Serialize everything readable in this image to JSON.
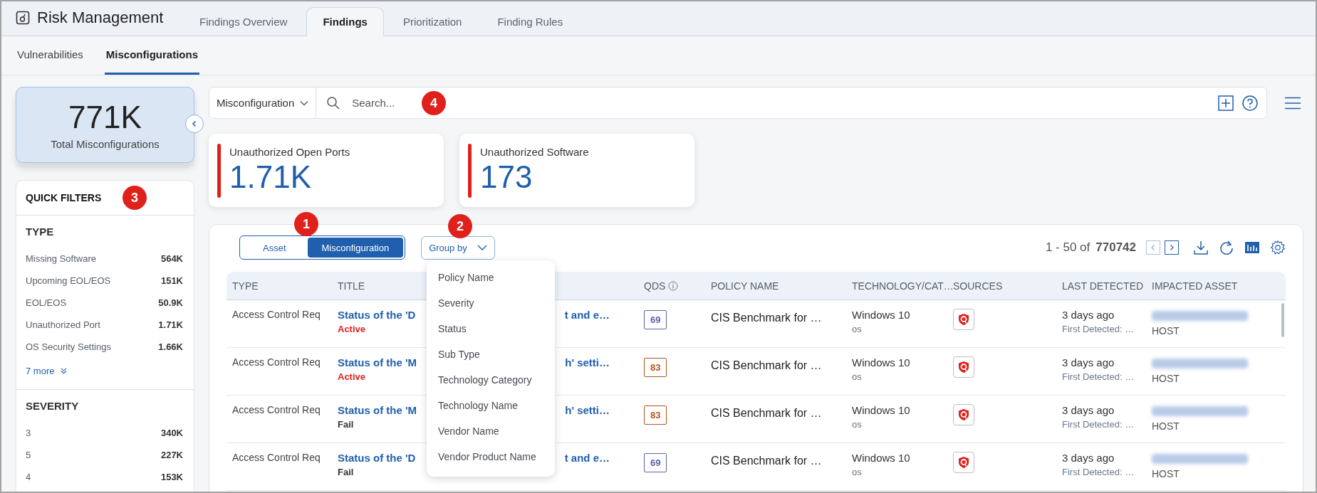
{
  "app": {
    "title": "Risk Management"
  },
  "tabs": [
    {
      "label": "Findings Overview",
      "selected": false
    },
    {
      "label": "Findings",
      "selected": true
    },
    {
      "label": "Prioritization",
      "selected": false
    },
    {
      "label": "Finding Rules",
      "selected": false
    }
  ],
  "subtabs": [
    {
      "label": "Vulnerabilities",
      "selected": false
    },
    {
      "label": "Misconfigurations",
      "selected": true
    }
  ],
  "total": {
    "value": "771K",
    "label": "Total Misconfigurations"
  },
  "quick_filters": {
    "title": "QUICK FILTERS",
    "sections": [
      {
        "title": "TYPE",
        "items": [
          {
            "label": "Missing Software",
            "count": "564K"
          },
          {
            "label": "Upcoming EOL/EOS",
            "count": "151K"
          },
          {
            "label": "EOL/EOS",
            "count": "50.9K"
          },
          {
            "label": "Unauthorized Port",
            "count": "1.71K"
          },
          {
            "label": "OS Security Settings",
            "count": "1.66K"
          }
        ],
        "more": "7 more"
      },
      {
        "title": "SEVERITY",
        "items": [
          {
            "label": "3",
            "count": "340K"
          },
          {
            "label": "5",
            "count": "227K"
          },
          {
            "label": "4",
            "count": "153K"
          }
        ]
      }
    ]
  },
  "search": {
    "scope": "Misconfiguration",
    "placeholder": "Search..."
  },
  "stat_cards": [
    {
      "label": "Unauthorized Open Ports",
      "value": "1.71K"
    },
    {
      "label": "Unauthorized Software",
      "value": "173"
    }
  ],
  "view_toggle": [
    {
      "label": "Asset",
      "selected": false
    },
    {
      "label": "Misconfiguration",
      "selected": true
    }
  ],
  "group_by": {
    "label": "Group by",
    "expanded": true,
    "options": [
      "Policy Name",
      "Severity",
      "Status",
      "Sub Type",
      "Technology Category",
      "Technology Name",
      "Vendor Name",
      "Vendor Product Name"
    ]
  },
  "pagination": {
    "range": "1 - 50 of",
    "total": "770742"
  },
  "table": {
    "columns": [
      "TYPE",
      "TITLE",
      "QDS",
      "POLICY NAME",
      "TECHNOLOGY/CAT…",
      "SOURCES",
      "LAST DETECTED",
      "IMPACTED ASSET"
    ],
    "rows": [
      {
        "type": "Access Control Req",
        "title_start": "Status of the 'D",
        "title_end": "t and e…",
        "status": {
          "label": "Active",
          "color": "#e0201b"
        },
        "qds": {
          "label": "69",
          "color": "#5a5fb0"
        },
        "policy": "CIS Benchmark for …",
        "technology": "Windows 10",
        "category": "os",
        "last_detected": "3 days ago",
        "first_detected": "First Detected: …",
        "asset_type": "HOST"
      },
      {
        "type": "Access Control Req",
        "title_start": "Status of the 'M",
        "title_end": "h' setti…",
        "status": {
          "label": "Active",
          "color": "#e0201b"
        },
        "qds": {
          "label": "83",
          "color": "#b5541c"
        },
        "policy": "CIS Benchmark for …",
        "technology": "Windows 10",
        "category": "os",
        "last_detected": "3 days ago",
        "first_detected": "First Detected: …",
        "asset_type": "HOST"
      },
      {
        "type": "Access Control Req",
        "title_start": "Status of the 'M",
        "title_end": "h' setti…",
        "status": {
          "label": "Fail",
          "color": "#333333"
        },
        "qds": {
          "label": "83",
          "color": "#b5541c"
        },
        "policy": "CIS Benchmark for …",
        "technology": "Windows 10",
        "category": "os",
        "last_detected": "3 days ago",
        "first_detected": "First Detected: …",
        "asset_type": "HOST"
      },
      {
        "type": "Access Control Req",
        "title_start": "Status of the 'D",
        "title_end": "t and e…",
        "status": {
          "label": "Fail",
          "color": "#333333"
        },
        "qds": {
          "label": "69",
          "color": "#5a5fb0"
        },
        "policy": "CIS Benchmark for …",
        "technology": "Windows 10",
        "category": "os",
        "last_detected": "3 days ago",
        "first_detected": "First Detected: …",
        "asset_type": "HOST"
      }
    ]
  },
  "markers": [
    "1",
    "2",
    "3",
    "4"
  ]
}
